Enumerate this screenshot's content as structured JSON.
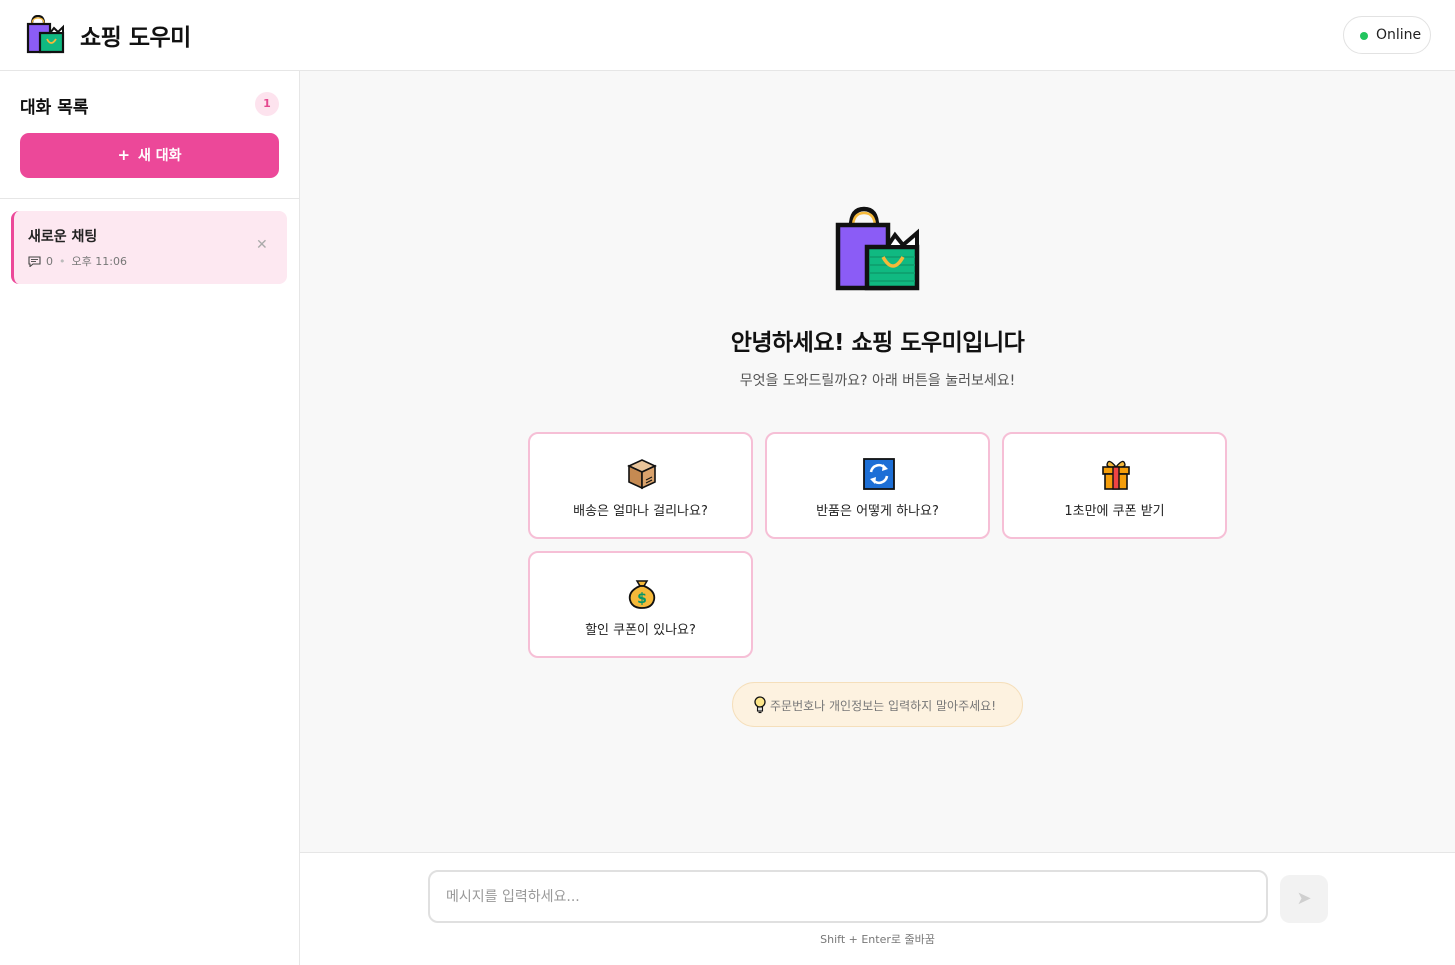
{
  "app": {
    "title": "쇼핑 도우미",
    "status": "Online",
    "logo_icon": "shopping-bags-icon"
  },
  "colors": {
    "accent": "#ec4899",
    "accent_light": "#fde8f1",
    "online": "#22c55e"
  },
  "sidebar": {
    "title": "대화 목록",
    "count": "1",
    "new_chat_label": "새 대화",
    "conversations": [
      {
        "title": "새로운 채팅",
        "message_count": "0",
        "time": "오후 11:06"
      }
    ]
  },
  "welcome": {
    "title": "안녕하세요! 쇼핑 도우미입니다",
    "subtitle": "무엇을 도와드릴까요? 아래 버튼을 눌러보세요!"
  },
  "quick_actions": [
    {
      "icon": "package-icon",
      "label": "배송은 얼마나 걸리나요?"
    },
    {
      "icon": "refresh-icon",
      "label": "반품은 어떻게 하나요?"
    },
    {
      "icon": "gift-icon",
      "label": "1초만에 쿠폰 받기"
    },
    {
      "icon": "money-bag-icon",
      "label": "할인 쿠폰이 있나요?"
    }
  ],
  "tip": {
    "icon": "lightbulb-icon",
    "text": "주문번호나 개인정보는 입력하지 말아주세요!"
  },
  "composer": {
    "placeholder": "메시지를 입력하세요...",
    "send_icon": "send-icon",
    "hint": "Shift + Enter로 줄바꿈"
  }
}
